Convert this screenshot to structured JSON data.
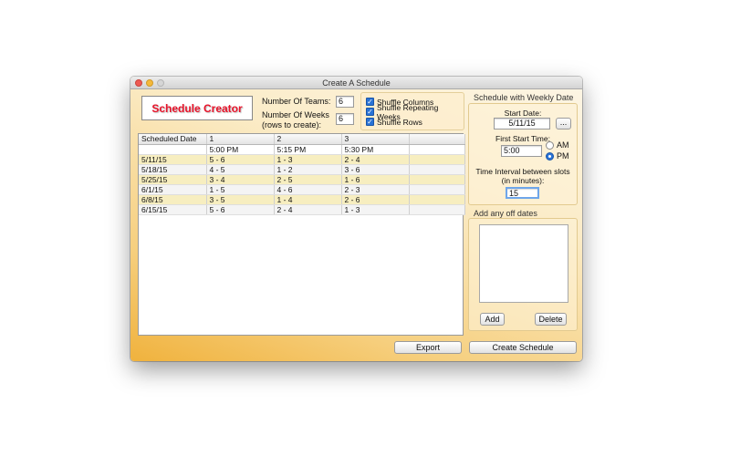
{
  "window": {
    "title": "Create A Schedule"
  },
  "logo": {
    "text": "Schedule Creator"
  },
  "teams": {
    "label": "Number Of Teams:",
    "value": "6"
  },
  "weeks": {
    "label_line1": "Number Of Weeks",
    "label_line2": "(rows to create):",
    "value": "6"
  },
  "shuffle": {
    "options": [
      {
        "label": "Shuffle Columns",
        "checked": true
      },
      {
        "label": "Shuffle Repeating Weeks",
        "checked": true
      },
      {
        "label": "Shuffle Rows",
        "checked": true
      }
    ]
  },
  "table": {
    "headers": [
      "Scheduled Date",
      "1",
      "2",
      "3",
      ""
    ],
    "times": [
      "",
      "5:00 PM",
      "5:15 PM",
      "5:30 PM",
      ""
    ],
    "rows": [
      [
        "5/11/15",
        "5 - 6",
        "1 - 3",
        "2 - 4",
        ""
      ],
      [
        "5/18/15",
        "4 - 5",
        "1 - 2",
        "3 - 6",
        ""
      ],
      [
        "5/25/15",
        "3 - 4",
        "2 - 5",
        "1 - 6",
        ""
      ],
      [
        "6/1/15",
        "1 - 5",
        "4 - 6",
        "2 - 3",
        ""
      ],
      [
        "6/8/15",
        "3 - 5",
        "1 - 4",
        "2 - 6",
        ""
      ],
      [
        "6/15/15",
        "5 - 6",
        "2 - 4",
        "1 - 3",
        ""
      ]
    ]
  },
  "weekly": {
    "title": "Schedule with Weekly Date",
    "start_date_label": "Start Date:",
    "start_date_value": "5/11/15",
    "picker_label": "...",
    "first_start_label": "First Start Time:",
    "first_start_value": "5:00",
    "am_label": "AM",
    "pm_label": "PM",
    "interval_label_line1": "Time Interval between slots",
    "interval_label_line2": "(in minutes):",
    "interval_value": "15"
  },
  "off_dates": {
    "title": "Add any off dates",
    "add_label": "Add",
    "delete_label": "Delete"
  },
  "footer": {
    "export_label": "Export",
    "create_label": "Create Schedule"
  }
}
